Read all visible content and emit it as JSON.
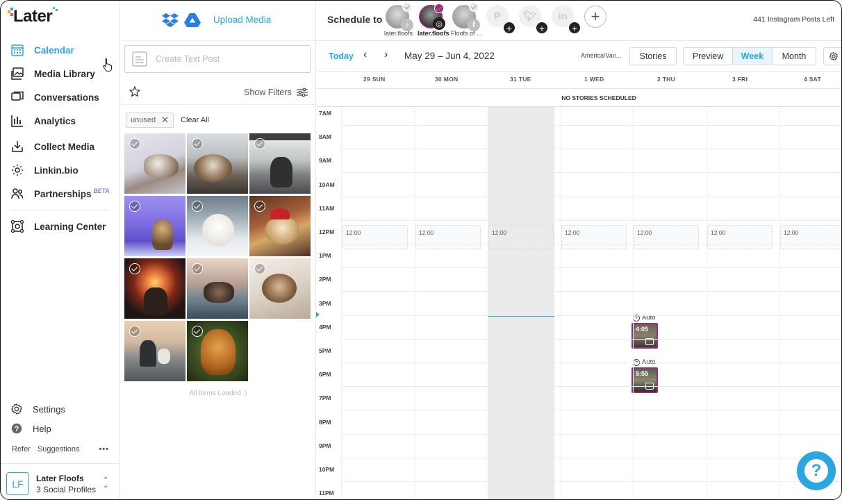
{
  "brand": {
    "logo_text": "Later",
    "accent": "#2aa6e0"
  },
  "nav": {
    "items": [
      {
        "label": "Calendar",
        "icon": "calendar-icon",
        "active": true
      },
      {
        "label": "Media Library",
        "icon": "image-icon"
      },
      {
        "label": "Conversations",
        "icon": "chat-icon"
      },
      {
        "label": "Analytics",
        "icon": "bar-chart-icon"
      },
      {
        "label": "Collect Media",
        "icon": "download-tray-icon"
      },
      {
        "label": "Linkin.bio",
        "icon": "link-icon"
      },
      {
        "label": "Partnerships",
        "icon": "people-icon",
        "badge": "BETA"
      },
      {
        "label": "Learning Center",
        "icon": "learning-icon"
      }
    ],
    "settings": "Settings",
    "help": "Help",
    "refer": "Refer",
    "suggestions": "Suggestions",
    "more": "•••",
    "profile": {
      "initials": "LF",
      "name": "Later Floofs",
      "sub": "3 Social Profiles"
    }
  },
  "media": {
    "upload_label": "Upload Media",
    "text_post_placeholder": "Create Text Post",
    "show_filters": "Show Filters",
    "tag": "unused",
    "clear_all": "Clear All",
    "loaded": "All Items Loaded :)",
    "thumbs": [
      {
        "name": "cat-lying"
      },
      {
        "name": "cat-window"
      },
      {
        "name": "cat-snowy-window"
      },
      {
        "name": "dog-purple-night"
      },
      {
        "name": "samoyed-snow"
      },
      {
        "name": "dog-santa-hat"
      },
      {
        "name": "dogs-lights"
      },
      {
        "name": "woman-dog-couch"
      },
      {
        "name": "pug-blanket"
      },
      {
        "name": "man-dog-mountain"
      },
      {
        "name": "golden-dog-forest"
      }
    ]
  },
  "schedule": {
    "label": "Schedule to",
    "accounts": [
      {
        "name": "later.floofs",
        "network": "tiktok",
        "selected": false
      },
      {
        "name": "later.floofs",
        "network": "instagram",
        "selected": true
      },
      {
        "name": "Floofs of ...",
        "network": "facebook",
        "selected": false
      }
    ],
    "ghost_networks": [
      "pinterest",
      "twitter",
      "linkedin"
    ],
    "posts_left": "441 Instagram Posts Left"
  },
  "toolbar": {
    "today": "Today",
    "prev": "‹",
    "next": "›",
    "range": "May 29 – Jun 4, 2022",
    "timezone": "America/Van...",
    "stories": "Stories",
    "preview": "Preview",
    "week": "Week",
    "month": "Month"
  },
  "calendar": {
    "days": [
      "29 SUN",
      "30 MON",
      "31 TUE",
      "1 WED",
      "2 THU",
      "3 FRI",
      "4 SAT"
    ],
    "no_stories": "NO STORIES SCHEDULED",
    "hours": [
      "7AM",
      "8AM",
      "9AM",
      "10AM",
      "11AM",
      "12PM",
      "1PM",
      "2PM",
      "3PM",
      "4PM",
      "5PM",
      "6PM",
      "7PM",
      "8PM",
      "9PM",
      "10PM",
      "11PM"
    ],
    "slot_time": "12:00",
    "posts": [
      {
        "auto": "Auto",
        "time": "4:05",
        "day": "2 THU"
      },
      {
        "auto": "Auto",
        "time": "5:55",
        "day": "2 THU"
      }
    ]
  },
  "help_label": "?"
}
